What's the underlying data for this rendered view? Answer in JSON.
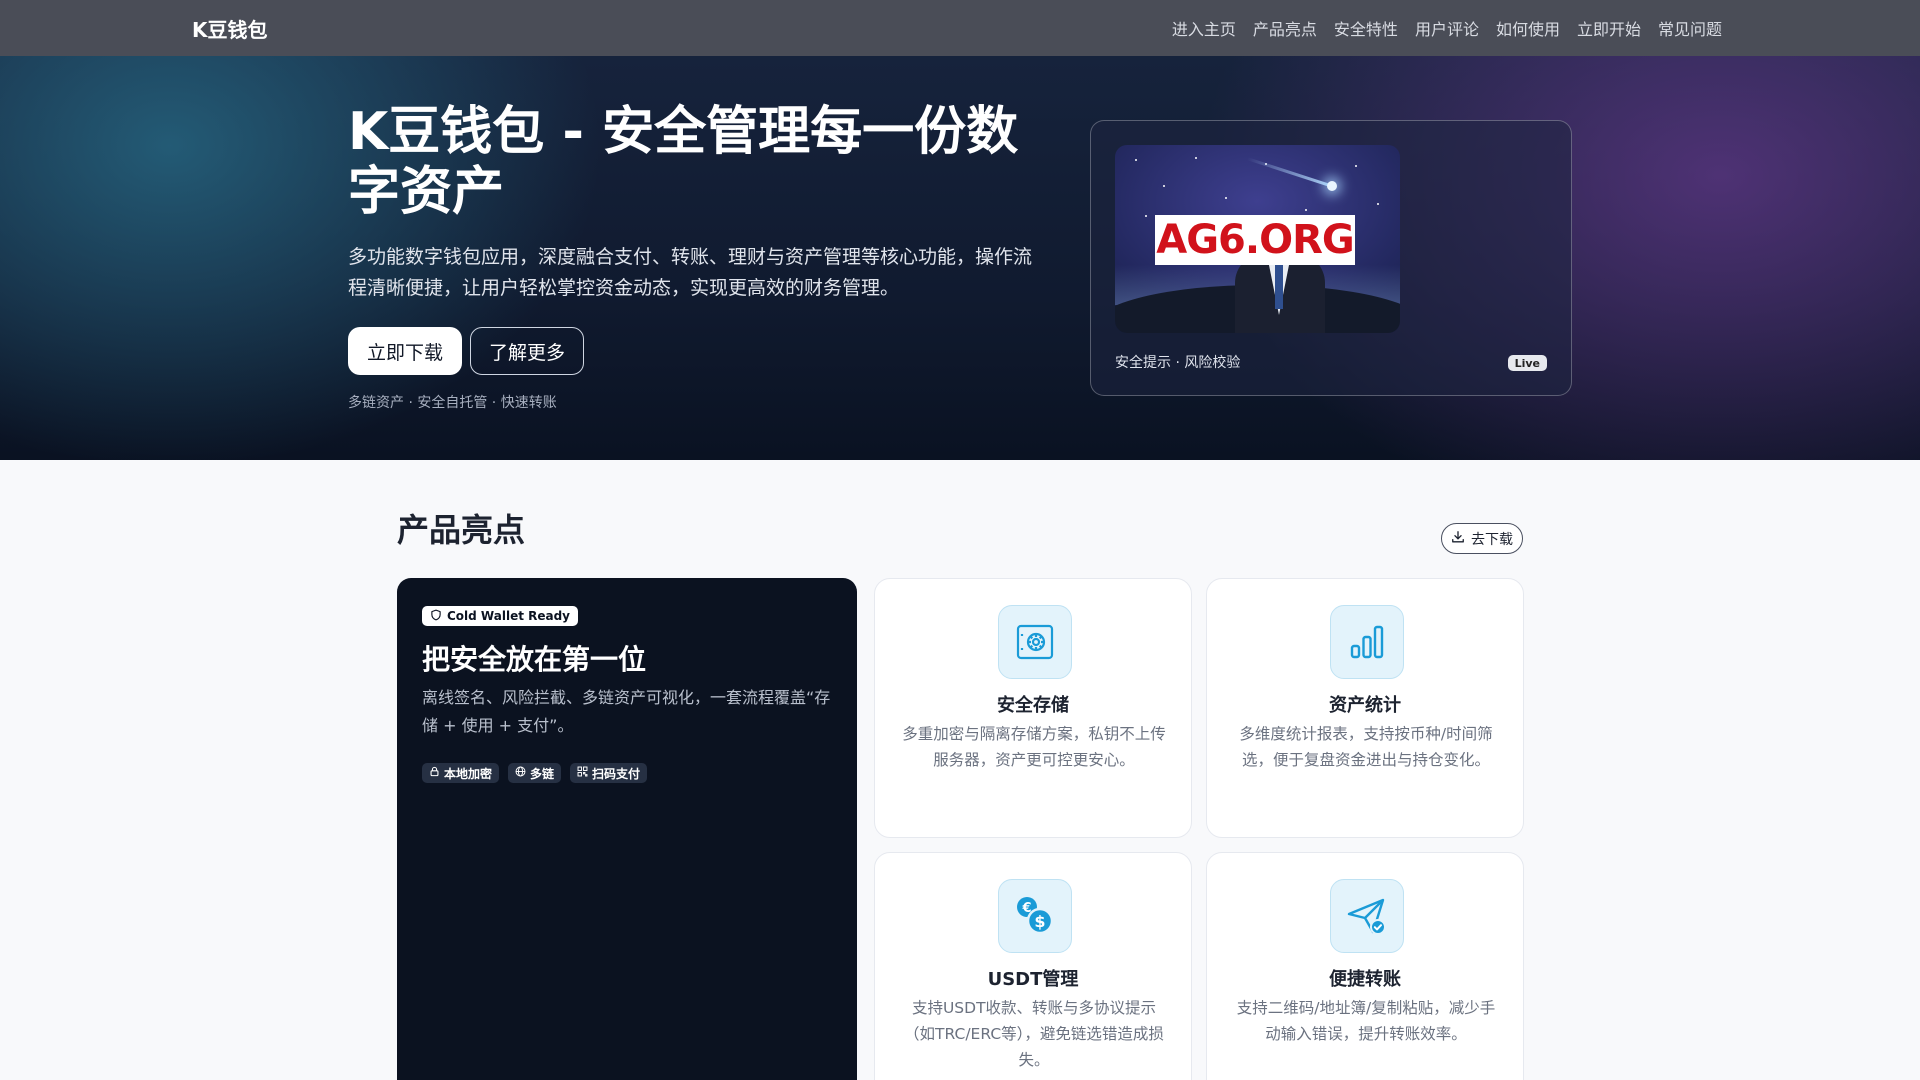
{
  "nav": {
    "brand": "K豆钱包",
    "links": [
      "进入主页",
      "产品亮点",
      "安全特性",
      "用户评论",
      "如何使用",
      "立即开始",
      "常见问题"
    ]
  },
  "hero": {
    "title": "K豆钱包 - 安全管理每一份数字资产",
    "description": "多功能数字钱包应用，深度融合支付、转账、理财与资产管理等核心功能，操作流程清晰便捷，让用户轻松掌控资金动态，实现更高效的财务管理。",
    "primary_button": "立即下载",
    "secondary_button": "了解更多",
    "tagline": "多链资产 · 安全自托管 · 快速转账",
    "card": {
      "image_sign": "AG6.ORG",
      "caption": "安全提示 · 风险校验",
      "badge": "Live"
    }
  },
  "highlights": {
    "title": "产品亮点",
    "download_pill": "去下载",
    "featured": {
      "badge": "Cold Wallet Ready",
      "title": "把安全放在第一位",
      "description": "离线签名、风险拦截、多链资产可视化，一套流程覆盖“存储 + 使用 + 支付”。",
      "chips": [
        "本地加密",
        "多链",
        "扫码支付"
      ]
    },
    "features": [
      {
        "title": "安全存储",
        "description": "多重加密与隔离存储方案，私钥不上传服务器，资产更可控更安心。",
        "icon": "safe-icon"
      },
      {
        "title": "资产统计",
        "description": "多维度统计报表，支持按币种/时间筛选，便于复盘资金进出与持仓变化。",
        "icon": "bar-chart-icon"
      },
      {
        "title": "USDT管理",
        "description": "支持USDT收款、转账与多协议提示（如TRC/ERC等），避免链选错造成损失。",
        "icon": "currency-exchange-icon"
      },
      {
        "title": "便捷转账",
        "description": "支持二维码/地址簿/复制粘贴，减少手动输入错误，提升转账效率。",
        "icon": "send-check-icon"
      }
    ],
    "accent_color": "#1a9bd7"
  }
}
